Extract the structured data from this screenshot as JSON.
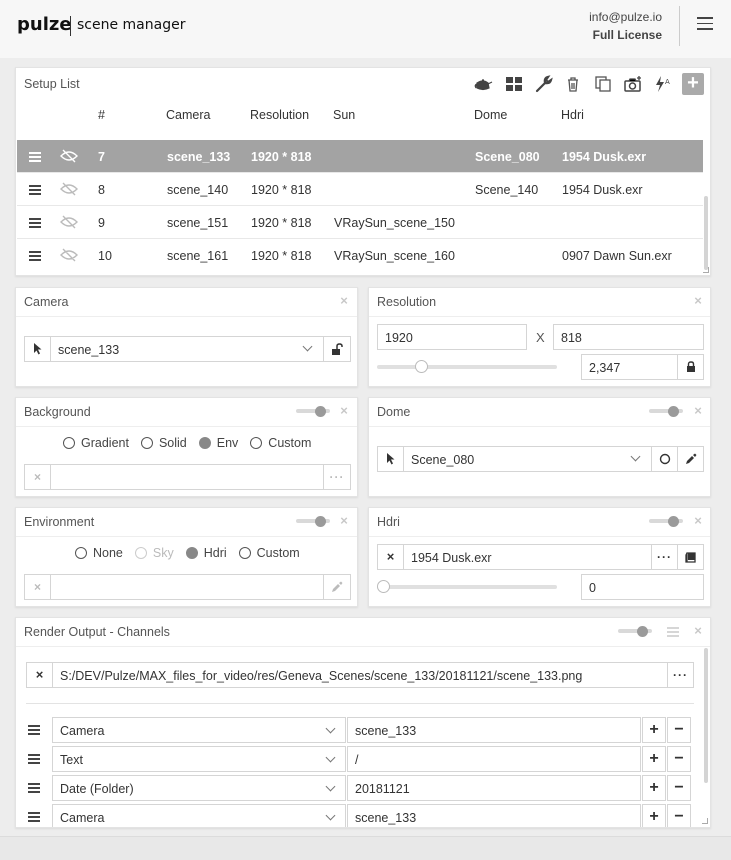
{
  "header": {
    "logo": "pulze",
    "subtitle": "scene manager",
    "email": "info@pulze.io",
    "license": "Full License"
  },
  "setup_list": {
    "title": "Setup List",
    "toolbar_icons": [
      "teapot-icon",
      "grid-icon",
      "wrench-icon",
      "trash-icon",
      "copy-icon",
      "camera-add-icon",
      "lightning-a-icon",
      "plus-icon"
    ],
    "columns": [
      "#",
      "Camera",
      "Resolution",
      "Sun",
      "Dome",
      "Hdri"
    ],
    "rows": [
      {
        "num": "7",
        "camera": "scene_133",
        "resolution": "1920 * 818",
        "sun": "",
        "dome": "Scene_080",
        "hdri": "1954 Dusk.exr",
        "selected": true
      },
      {
        "num": "8",
        "camera": "scene_140",
        "resolution": "1920 * 818",
        "sun": "",
        "dome": "Scene_140",
        "hdri": "1954 Dusk.exr",
        "selected": false
      },
      {
        "num": "9",
        "camera": "scene_151",
        "resolution": "1920 * 818",
        "sun": "VRaySun_scene_150",
        "dome": "",
        "hdri": "",
        "selected": false
      },
      {
        "num": "10",
        "camera": "scene_161",
        "resolution": "1920 * 818",
        "sun": "VRaySun_scene_160",
        "dome": "",
        "hdri": "0907 Dawn Sun.exr",
        "selected": false
      }
    ]
  },
  "camera": {
    "title": "Camera",
    "value": "scene_133"
  },
  "resolution": {
    "title": "Resolution",
    "width": "1920",
    "x_label": "X",
    "height": "818",
    "ratio": "2,347"
  },
  "background": {
    "title": "Background",
    "options": [
      "Gradient",
      "Solid",
      "Env",
      "Custom"
    ],
    "selected": "Env"
  },
  "dome": {
    "title": "Dome",
    "value": "Scene_080"
  },
  "environment": {
    "title": "Environment",
    "options": [
      "None",
      "Sky",
      "Hdri",
      "Custom"
    ],
    "selected": "Hdri",
    "disabled": "Sky"
  },
  "hdri": {
    "title": "Hdri",
    "file": "1954 Dusk.exr",
    "rotation": "0"
  },
  "render_output": {
    "title": "Render Output - Channels",
    "path": "S:/DEV/Pulze/MAX_files_for_video/res/Geneva_Scenes/scene_133/20181121/scene_133.png",
    "channels": [
      {
        "type": "Camera",
        "value": "scene_133"
      },
      {
        "type": "Text",
        "value": "/"
      },
      {
        "type": "Date (Folder)",
        "value": "20181121"
      },
      {
        "type": "Camera",
        "value": "scene_133"
      }
    ]
  }
}
